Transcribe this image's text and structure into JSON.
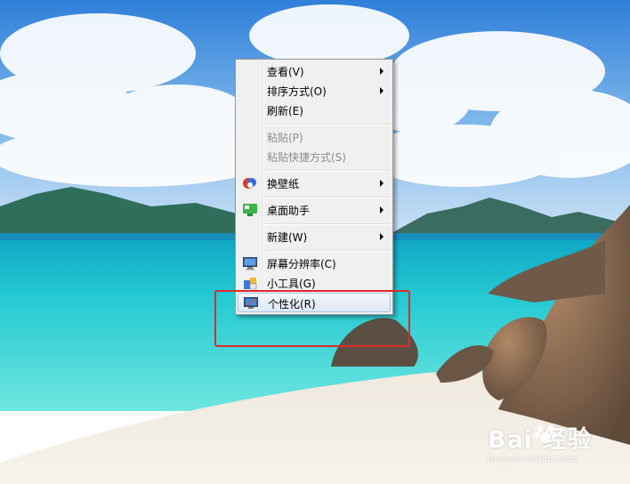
{
  "menu": {
    "items": [
      {
        "label": "查看(V)",
        "submenu": true
      },
      {
        "label": "排序方式(O)",
        "submenu": true
      },
      {
        "label": "刷新(E)",
        "submenu": false
      },
      {
        "label": "粘贴(P)",
        "disabled": true
      },
      {
        "label": "粘贴快捷方式(S)",
        "disabled": true
      },
      {
        "label": "换壁纸",
        "submenu": true,
        "icon": "wallpaper-icon"
      },
      {
        "label": "桌面助手",
        "submenu": true,
        "icon": "desktop-assistant-icon"
      },
      {
        "label": "新建(W)",
        "submenu": true
      },
      {
        "label": "屏幕分辨率(C)",
        "icon": "monitor-icon"
      },
      {
        "label": "小工具(G)",
        "icon": "gadgets-icon"
      },
      {
        "label": "个性化(R)",
        "icon": "personalize-icon",
        "hovered": true
      }
    ]
  },
  "watermark": {
    "brand": "Bai  经验",
    "url": "jingyan.baidu.com"
  },
  "colors": {
    "highlight_box": "#e02a2a",
    "menu_bg": "#f0f0f0",
    "hover_border": "#a9c3e6"
  }
}
